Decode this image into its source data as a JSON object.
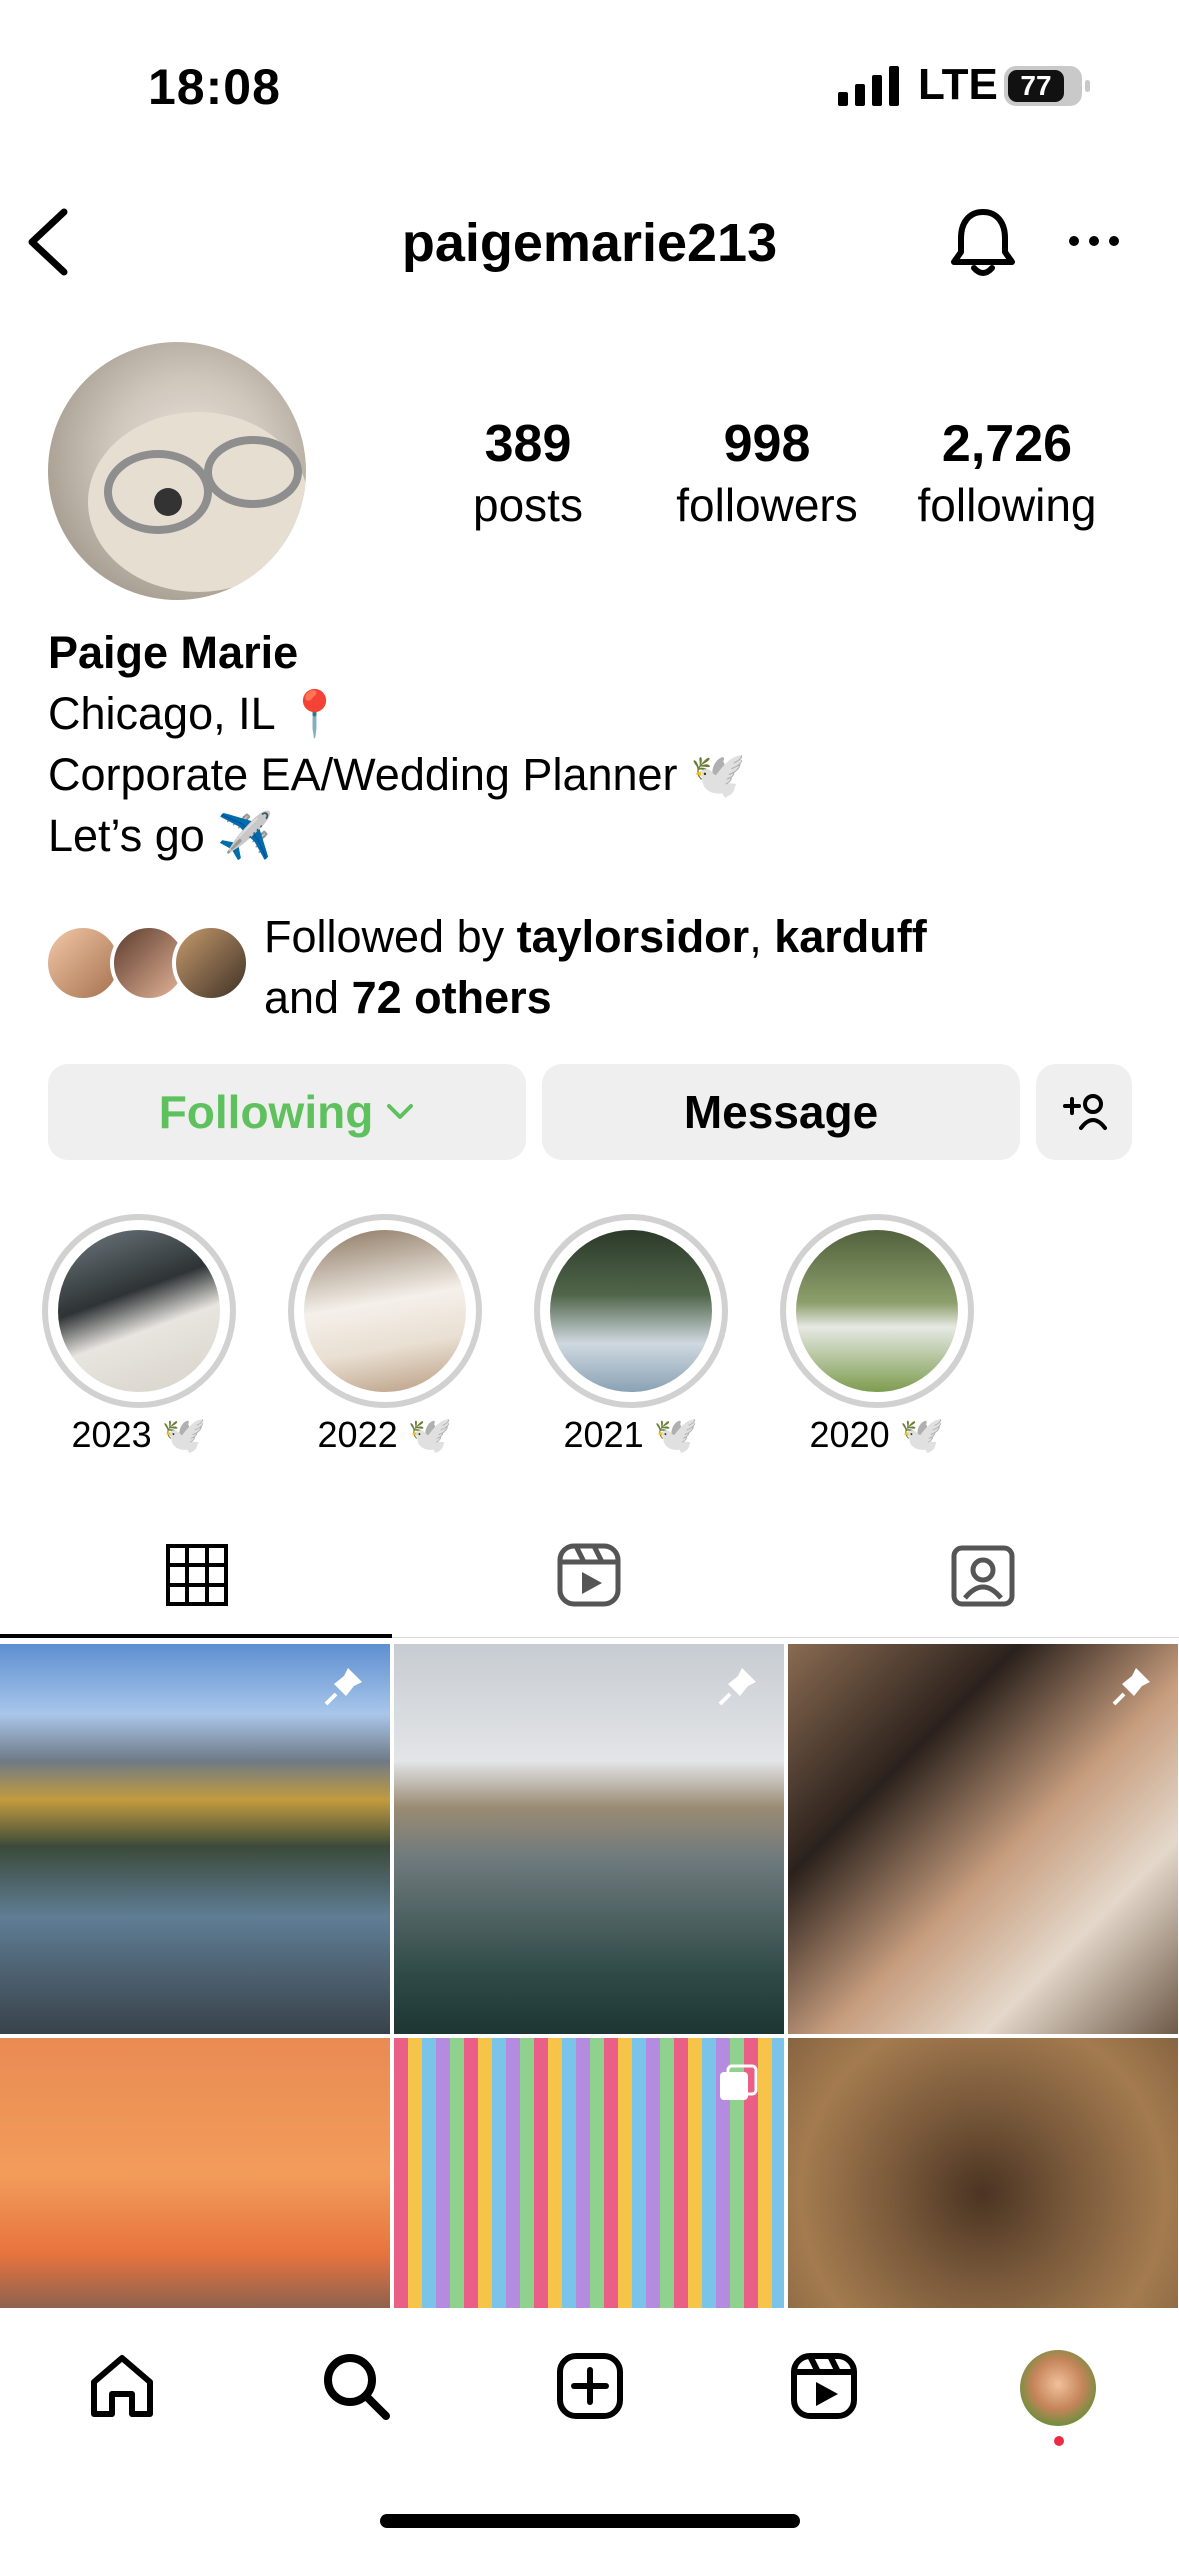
{
  "status_bar": {
    "time": "18:08",
    "network": "LTE",
    "battery": "77"
  },
  "header": {
    "username": "paigemarie213"
  },
  "stats": [
    {
      "value": "389",
      "label": "posts"
    },
    {
      "value": "998",
      "label": "followers"
    },
    {
      "value": "2,726",
      "label": "following"
    }
  ],
  "bio": {
    "name": "Paige Marie",
    "line1": "Chicago, IL 📍",
    "line2": "Corporate EA/Wedding Planner 🕊️",
    "line3": "Let’s go ✈️"
  },
  "followed_by": {
    "prefix": "Followed by ",
    "user1": "taylorsidor",
    "sep": ", ",
    "user2": "karduff",
    "mid": "and ",
    "others": "72 others"
  },
  "buttons": {
    "following": "Following",
    "message": "Message"
  },
  "highlights": [
    {
      "label": "2023 🕊️"
    },
    {
      "label": "2022 🕊️"
    },
    {
      "label": "2021 🕊️"
    },
    {
      "label": "2020 🕊️"
    }
  ],
  "tabs": [
    "grid-icon",
    "reels-icon",
    "tagged-icon"
  ],
  "nav": [
    "home-icon",
    "search-icon",
    "create-icon",
    "reels-icon",
    "profile-avatar"
  ],
  "colors": {
    "following_green": "#5fc15e",
    "notification_dot": "#ed2b43"
  }
}
